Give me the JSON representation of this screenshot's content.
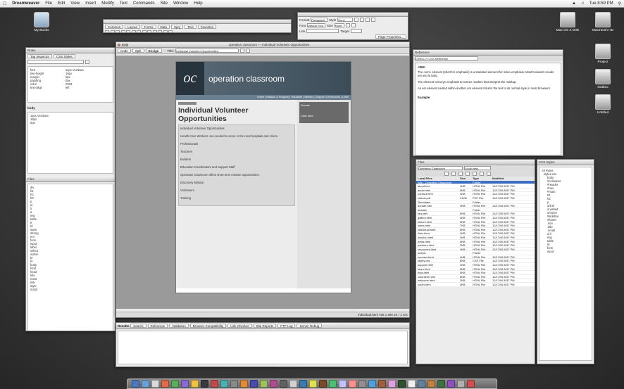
{
  "menubar": {
    "apple": "",
    "items": [
      "Dreamweaver",
      "File",
      "Edit",
      "View",
      "Insert",
      "Modify",
      "Text",
      "Commands",
      "Site",
      "Window",
      "Help"
    ],
    "clock": "Tue 8:59 PM"
  },
  "desktop_icons": [
    {
      "label": "My Books"
    },
    {
      "label": "Mac OS X Disk"
    },
    {
      "label": "Macintosh HD"
    },
    {
      "label": "Project"
    },
    {
      "label": "Outbox"
    },
    {
      "label": "Untitled"
    }
  ],
  "doc_window": {
    "title": "operation classroom — Individual Volunteer Opportunities",
    "tabs": [
      "Code",
      "Split",
      "Design"
    ],
    "title_label": "Title:",
    "title_value": "Individual Volunteer Opportunities",
    "site": {
      "logo": "oc",
      "name": "operation classroom",
      "nav": "Home | Mission & Purpose | Volunteer | Ministry | Support | Resources | Links",
      "heading_line1": "Individual Volunteer",
      "heading_line2": "Opportunities",
      "paragraphs": [
        "Individual Volunteer Opportunities",
        "Health Care Workers: are needed to serve in the rural hospitals and clinics.",
        "Professionals",
        "Teachers",
        "Builders",
        "Education Coordinators and Support Staff",
        "Operation Classroom offers short term mission opportunities.",
        "Discovery Mission",
        "Volunteers",
        "Training"
      ],
      "side_title": "Donate",
      "side_text": "Click here"
    },
    "status": "Individual.html  756 x 499  1K / 1 sec"
  },
  "insert_toolbar": {
    "tabs": [
      "Common",
      "Layout",
      "Forms",
      "Data",
      "Spry",
      "Text",
      "Favorites"
    ]
  },
  "properties_panel": {
    "labels": [
      "Format",
      "Style",
      "Font",
      "Size",
      "Link",
      "Target",
      "Page Properties..."
    ],
    "values": [
      "Paragraph",
      "None",
      "Default Font",
      "None"
    ]
  },
  "left_panel": {
    "header": "Rules",
    "tabs": [
      "Tag Inspector",
      "CSS Styles"
    ],
    "props": [
      {
        "k": "font",
        "v": "11px Verdana"
      },
      {
        "k": "line-height",
        "v": "16px"
      },
      {
        "k": "margin",
        "v": "0px"
      },
      {
        "k": "padding",
        "v": "0px"
      },
      {
        "k": "color",
        "v": "#333"
      },
      {
        "k": "text-align",
        "v": "left"
      }
    ],
    "rule": "body",
    "lower_header": "Files",
    "lower_items": [
      "div",
      "h1",
      "h2",
      "h3",
      "p",
      "ul",
      "li",
      "a",
      "img",
      "table",
      "tr",
      "td",
      "span",
      "strong",
      "em",
      "form",
      "input",
      "label",
      "select",
      "option",
      "br",
      "hr",
      "body",
      "html",
      "head",
      "title",
      "meta",
      "link",
      "style",
      "script"
    ]
  },
  "reference_panel": {
    "title": "Reference",
    "book": "O'REILLY CSS Reference",
    "heading": "<EM>",
    "paragraphs": [
      "The <em> element (short for emphasis) is a standard element for inline emphasis. Most browsers render em text in italic.",
      "The element conveys emphasis to screen readers that interpret the markup.",
      "An em element nested within another em element returns the text to its normal style in most browsers.",
      "Example"
    ]
  },
  "files_panel": {
    "title": "Files",
    "site": "Operation Classroom",
    "view": "Local view",
    "columns": [
      "Local Files",
      "Size",
      "Type",
      "Modified"
    ],
    "rows": [
      {
        "name": "Site - Operation Classroom",
        "size": "",
        "type": "Folder",
        "mod": "",
        "sel": true
      },
      {
        "name": "about.htm",
        "size": "4KB",
        "type": "HTML File",
        "mod": "12/17/06 8:57 PM"
      },
      {
        "name": "apply.html",
        "size": "5KB",
        "type": "HTML File",
        "mod": "12/17/06 8:57 PM"
      },
      {
        "name": "contact.html",
        "size": "3KB",
        "type": "HTML File",
        "mod": "12/17/06 8:57 PM"
      },
      {
        "name": "critical.pdf",
        "size": "41KB",
        "type": "PDF File",
        "mod": "12/17/06 8:57 PM"
      },
      {
        "name": "Templates",
        "size": "",
        "type": "Folder",
        "mod": ""
      },
      {
        "name": "donate.htm",
        "size": "3KB",
        "type": "HTML File",
        "mod": "12/17/06 8:57 PM"
      },
      {
        "name": "images",
        "size": "",
        "type": "Folder",
        "mod": ""
      },
      {
        "name": "faq.html",
        "size": "6KB",
        "type": "HTML File",
        "mod": "12/17/06 8:57 PM"
      },
      {
        "name": "gallery.html",
        "size": "4KB",
        "type": "HTML File",
        "mod": "12/17/06 8:57 PM"
      },
      {
        "name": "history.html",
        "size": "5KB",
        "type": "HTML File",
        "mod": "12/17/06 8:57 PM"
      },
      {
        "name": "index.html",
        "size": "7KB",
        "type": "HTML File",
        "mod": "12/17/06 8:57 PM"
      },
      {
        "name": "individual.html",
        "size": "5KB",
        "type": "HTML File",
        "mod": "12/17/06 8:57 PM"
      },
      {
        "name": "links.html",
        "size": "4KB",
        "type": "HTML File",
        "mod": "12/17/06 8:57 PM"
      },
      {
        "name": "mission.html",
        "size": "3KB",
        "type": "HTML File",
        "mod": "12/17/06 8:57 PM"
      },
      {
        "name": "news.html",
        "size": "6KB",
        "type": "HTML File",
        "mod": "12/17/06 8:57 PM"
      },
      {
        "name": "partners.html",
        "size": "3KB",
        "type": "HTML File",
        "mod": "12/17/06 8:57 PM"
      },
      {
        "name": "resources.html",
        "size": "4KB",
        "type": "HTML File",
        "mod": "12/17/06 8:57 PM"
      },
      {
        "name": "scripts",
        "size": "",
        "type": "Folder",
        "mod": ""
      },
      {
        "name": "sponsor.html",
        "size": "4KB",
        "type": "HTML File",
        "mod": "12/17/06 8:57 PM"
      },
      {
        "name": "styles.css",
        "size": "8KB",
        "type": "CSS File",
        "mod": "12/17/06 8:57 PM"
      },
      {
        "name": "support.html",
        "size": "4KB",
        "type": "HTML File",
        "mod": "12/17/06 8:57 PM"
      },
      {
        "name": "team.html",
        "size": "3KB",
        "type": "HTML File",
        "mod": "12/17/06 8:57 PM"
      },
      {
        "name": "trips.html",
        "size": "5KB",
        "type": "HTML File",
        "mod": "12/17/06 8:57 PM"
      },
      {
        "name": "volunteer.html",
        "size": "6KB",
        "type": "HTML File",
        "mod": "12/17/06 8:57 PM"
      },
      {
        "name": "welcome.html",
        "size": "3KB",
        "type": "HTML File",
        "mod": "12/17/06 8:57 PM"
      },
      {
        "name": "youth.html",
        "size": "4KB",
        "type": "HTML File",
        "mod": "12/17/06 8:57 PM"
      }
    ]
  },
  "assets_panel": {
    "title": "CSS Styles",
    "items": [
      "All Rules",
      "styles.css",
      "body",
      "#container",
      "#header",
      "#nav",
      "#main",
      "h1",
      "h2",
      "p",
      "a:link",
      "a:visited",
      "a:hover",
      "#sidebar",
      "#footer",
      ".box",
      ".title",
      ".small",
      "ul li",
      "img",
      "table",
      "td",
      "form",
      "input"
    ]
  },
  "results_panel": {
    "title": "Results",
    "tabs": [
      "Search",
      "Reference",
      "Validation",
      "Browser Compatibility",
      "Link Checker",
      "Site Reports",
      "FTP Log",
      "Server Debug"
    ]
  }
}
